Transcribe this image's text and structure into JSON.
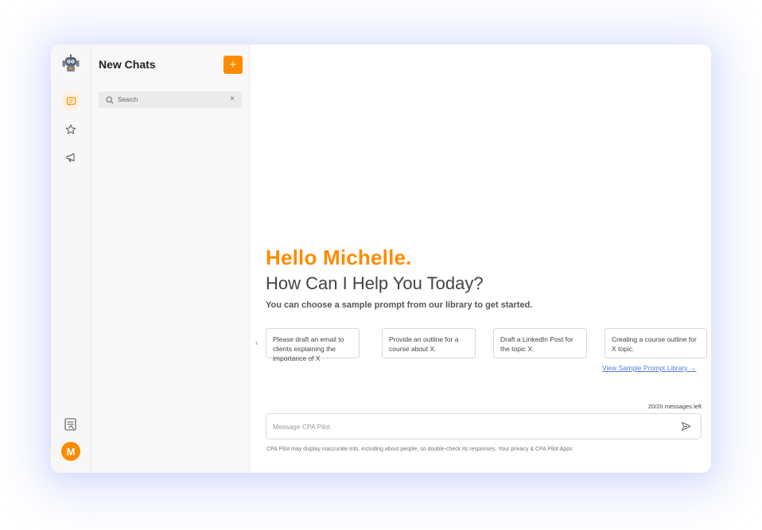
{
  "app": {
    "logo_icon": "robot-mascot-icon",
    "accent_color": "#fb8c00",
    "link_color": "#4a7de0"
  },
  "rail": {
    "items": [
      {
        "icon": "chat-icon",
        "active": true
      },
      {
        "icon": "star-icon",
        "active": false
      },
      {
        "icon": "megaphone-icon",
        "active": false
      }
    ],
    "bottom_icon": "library-icon",
    "avatar_initial": "M"
  },
  "chat_panel": {
    "title": "New Chats",
    "new_button_label": "+",
    "search": {
      "placeholder": "Search",
      "value": "",
      "clear_label": "×"
    }
  },
  "main": {
    "greeting": "Hello Michelle.",
    "headline": "How Can I Help You Today?",
    "subtext": "You can choose a sample prompt from our library to get started.",
    "prompts": [
      {
        "text": "Please draft an email to clients explaining the importance of X"
      },
      {
        "text": "Provide an outline for a course about X."
      },
      {
        "text": "Draft a LinkedIn Post for the topic X."
      },
      {
        "text": "Creating a course outline for X topic."
      }
    ],
    "library_link": "View Sample Prompt Library →",
    "messages_left": "20/20 messages left",
    "message_placeholder": "Message CPA Pilot",
    "disclaimer": "CPA Pilot may display inaccurate info, including about people, so double-check its responses. Your privacy & CPA Pilot Apps"
  }
}
